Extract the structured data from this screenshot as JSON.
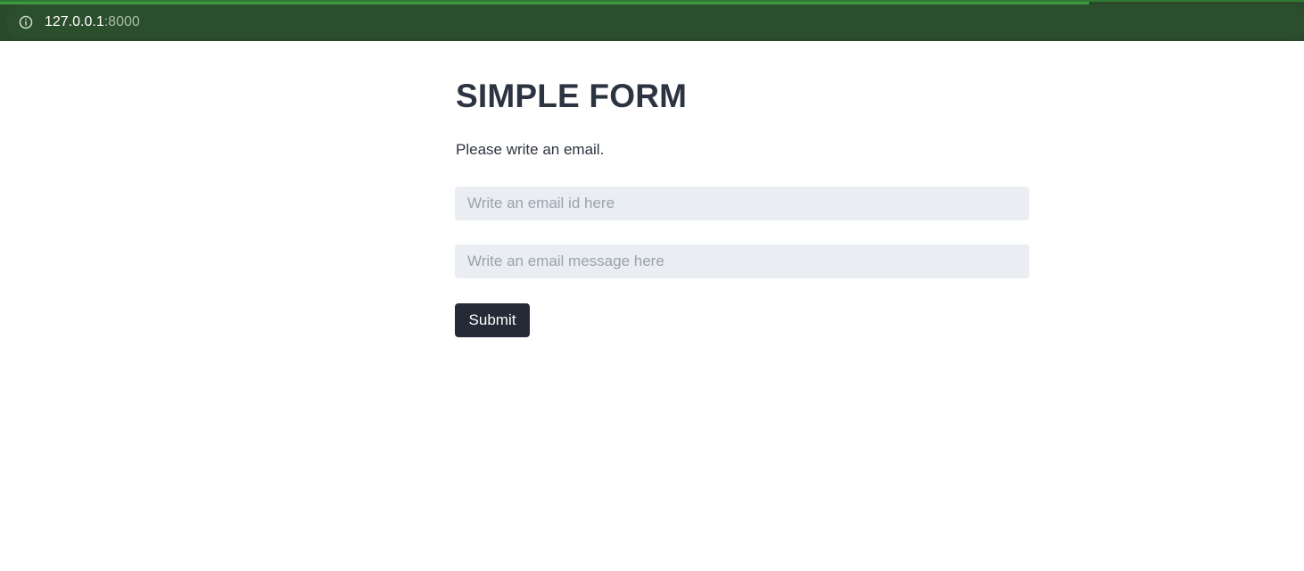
{
  "browser": {
    "url_host": "127.0.0.1",
    "url_port": ":8000",
    "info_icon": "info-icon",
    "progress": 0.835,
    "colors": {
      "toolbar": "#2a4a2b",
      "progress": "#3d9a40"
    }
  },
  "form": {
    "title": "SIMPLE FORM",
    "description": "Please write an email.",
    "email_placeholder": "Write an email id here",
    "email_value": "",
    "message_placeholder": "Write an email message here",
    "message_value": "",
    "submit_label": "Submit",
    "colors": {
      "text": "#2d3441",
      "input_bg": "#eaeef2",
      "button_bg": "#242a36"
    }
  }
}
